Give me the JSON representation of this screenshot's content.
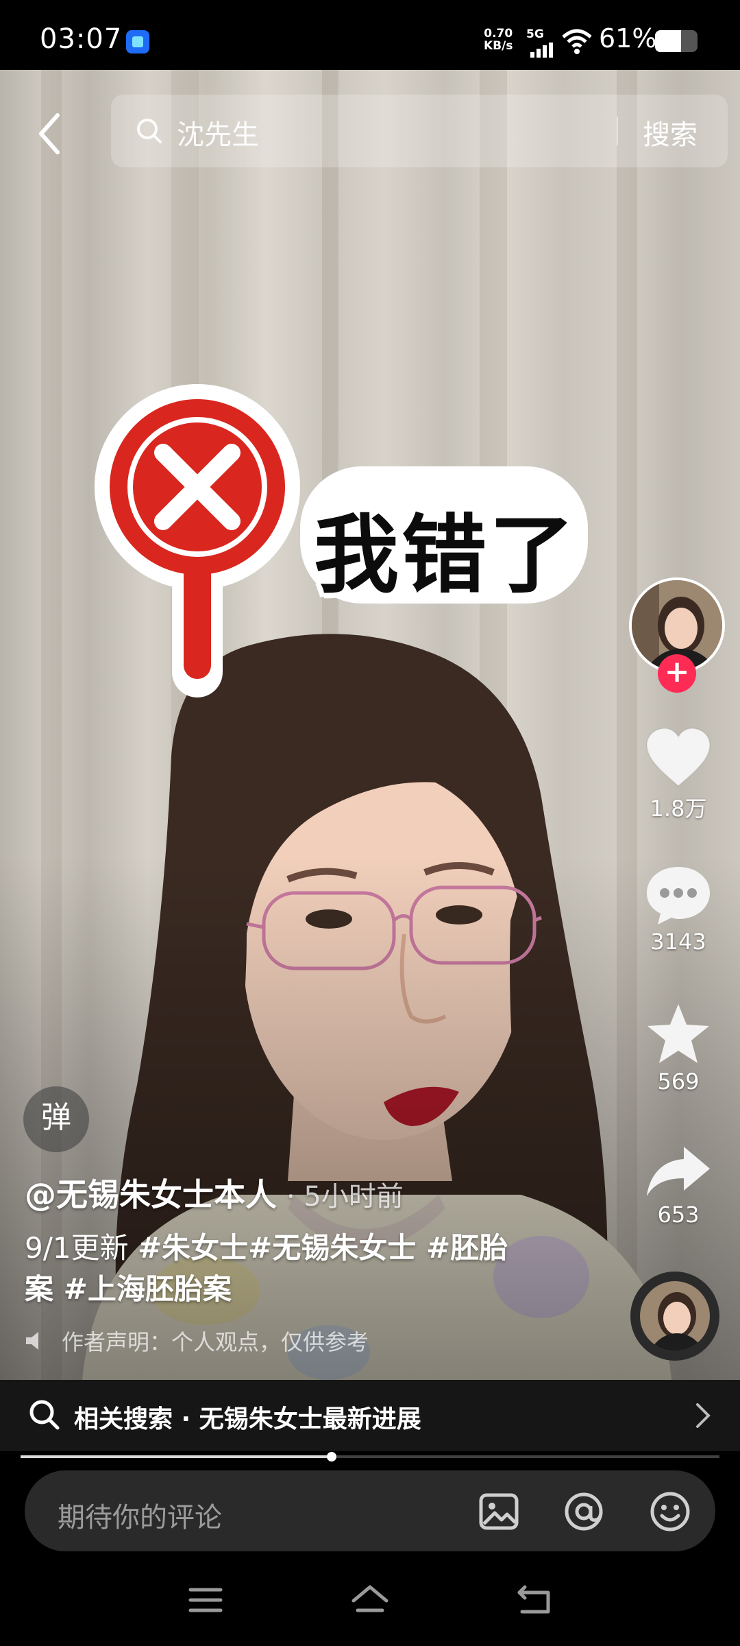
{
  "status_bar": {
    "time": "03:07",
    "net_speed_value": "0.70",
    "net_speed_unit": "KB/s",
    "network": "5G",
    "battery_text": "61%",
    "battery_level": 0.61
  },
  "search": {
    "query": "沈先生",
    "button_label": "搜索"
  },
  "sticker": {
    "text": "我错了"
  },
  "actions": {
    "likes": "1.8万",
    "comments": "3143",
    "favorites": "569",
    "shares": "653",
    "follow_symbol": "+"
  },
  "danmu": {
    "label": "弹"
  },
  "post": {
    "author": "@无锡朱女士本人",
    "time": "· 5小时前",
    "desc_prefix": "9/1更新 ",
    "tags_line1": "#朱女士#无锡朱女士 #胚胎",
    "tags_line2": "案 #上海胚胎案",
    "disclaimer": "作者声明：个人观点，仅供参考"
  },
  "related": {
    "label": "相关搜索 · 无锡朱女士最新进展"
  },
  "progress": {
    "fraction": 0.445
  },
  "comment": {
    "placeholder": "期待你的评论"
  },
  "colors": {
    "follow": "#fe2c55",
    "background": "#000000"
  }
}
